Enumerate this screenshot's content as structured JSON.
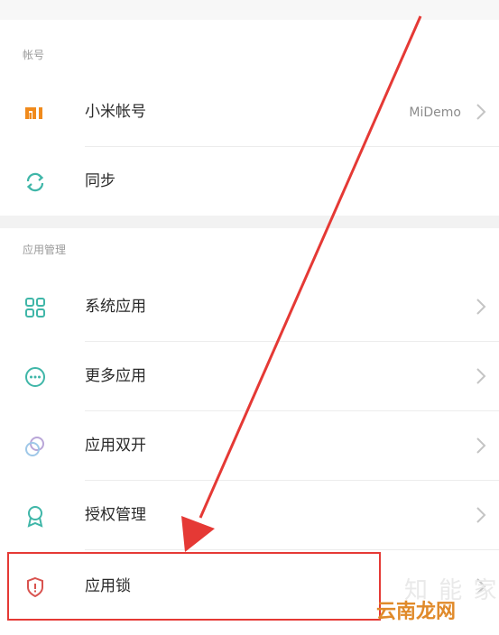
{
  "sections": {
    "account": {
      "header": "帐号"
    },
    "apps": {
      "header": "应用管理"
    }
  },
  "rows": {
    "mi_account": {
      "label": "小米帐号",
      "value": "MiDemo",
      "icon": "mi-logo-icon"
    },
    "sync": {
      "label": "同步",
      "icon": "sync-icon"
    },
    "system_apps": {
      "label": "系统应用",
      "icon": "grid-icon"
    },
    "more_apps": {
      "label": "更多应用",
      "icon": "more-dots-icon"
    },
    "dual_apps": {
      "label": "应用双开",
      "icon": "dual-circles-icon"
    },
    "permissions": {
      "label": "授权管理",
      "icon": "badge-icon"
    },
    "app_lock": {
      "label": "应用锁",
      "icon": "shield-lock-icon"
    }
  },
  "annotation": {
    "arrow_color": "#e53935",
    "highlight_color": "#e53935"
  },
  "watermark": {
    "line1": "知 能 家",
    "line2": "云南龙网"
  },
  "colors": {
    "mi_orange": "#f08a1c",
    "teal": "#3fb6a8",
    "text": "#2a2a2a",
    "subtext": "#9a9a9a"
  }
}
